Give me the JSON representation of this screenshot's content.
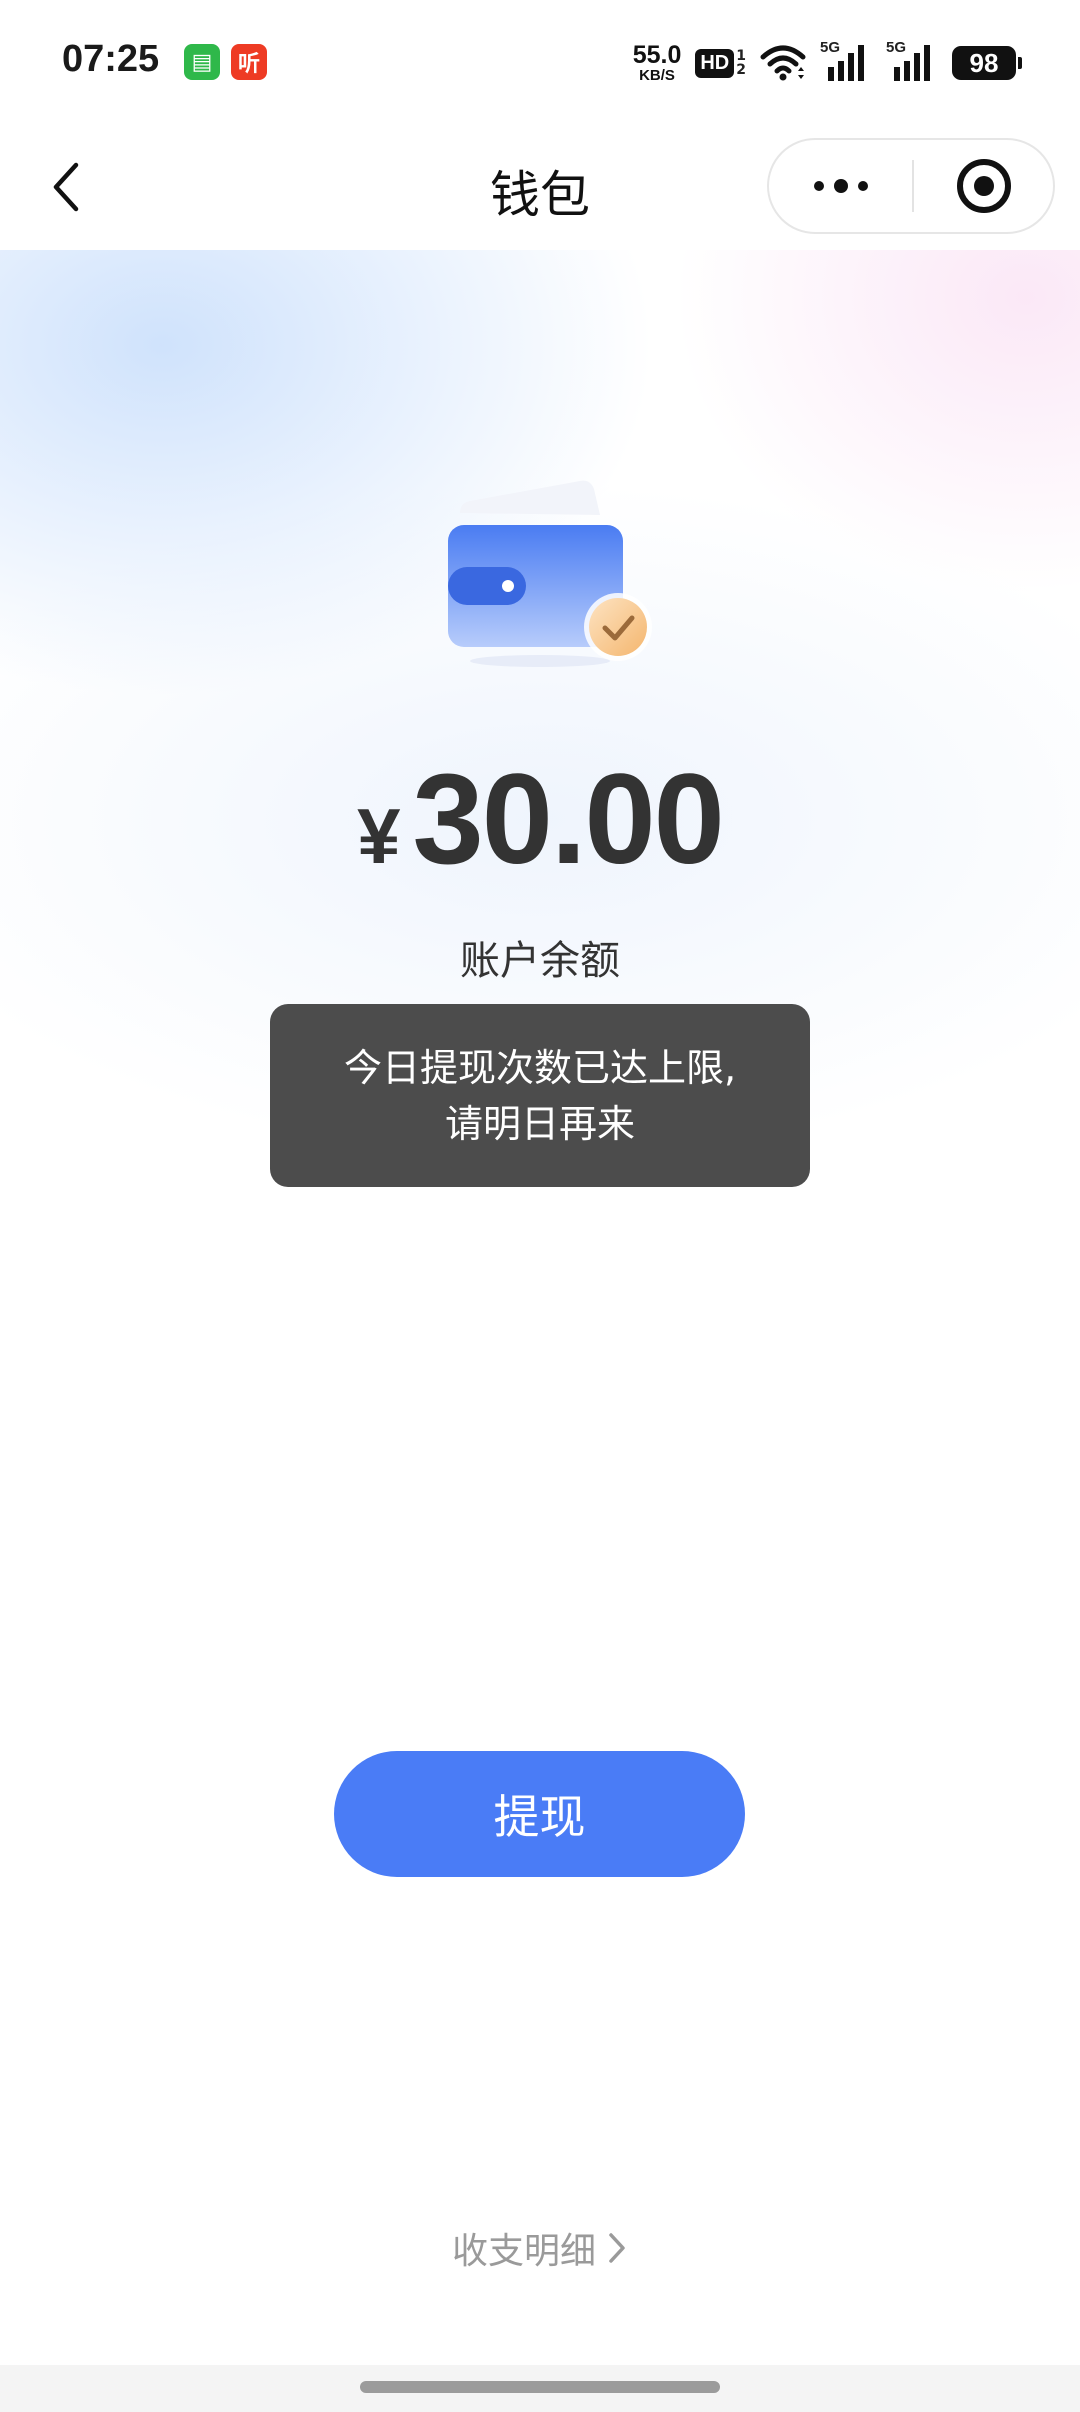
{
  "status_bar": {
    "time": "07:25",
    "app_icons": [
      {
        "name": "message-app-icon",
        "glyph": "▤",
        "color": "#2fb84a"
      },
      {
        "name": "listen-app-icon",
        "glyph": "听",
        "color": "#ee3b24"
      }
    ],
    "net_speed_value": "55.0",
    "net_speed_unit": "KB/S",
    "hd_label": "HD",
    "hd_sub_top": "1",
    "hd_sub_bottom": "2",
    "signal_1_label": "5G",
    "signal_2_label": "5G",
    "battery": "98"
  },
  "nav": {
    "title": "钱包"
  },
  "wallet": {
    "currency_symbol": "¥",
    "balance": "30.00",
    "balance_label": "账户余额"
  },
  "toast": {
    "line1": "今日提现次数已达上限,",
    "line2": "请明日再来"
  },
  "actions": {
    "withdraw_label": "提现",
    "details_label": "收支明细"
  },
  "colors": {
    "primary_button": "#4a7cf6",
    "toast_bg": "#4c4c4c",
    "wallet_blue": "#4f7ef0",
    "check_badge": "#f6c58a"
  }
}
